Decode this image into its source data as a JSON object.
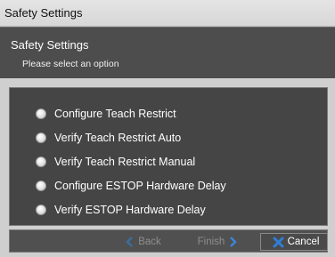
{
  "window": {
    "title": "Safety Settings"
  },
  "header": {
    "title": "Safety Settings",
    "subtitle": "Please select an option"
  },
  "options": [
    {
      "label": "Configure Teach Restrict",
      "selected": false
    },
    {
      "label": "Verify Teach Restrict Auto",
      "selected": false
    },
    {
      "label": "Verify Teach Restrict Manual",
      "selected": false
    },
    {
      "label": "Configure ESTOP Hardware Delay",
      "selected": false
    },
    {
      "label": "Verify ESTOP Hardware Delay",
      "selected": false
    }
  ],
  "footer": {
    "back_label": "Back",
    "finish_label": "Finish",
    "cancel_label": "Cancel",
    "back_enabled": false,
    "finish_enabled": false,
    "cancel_enabled": true
  },
  "colors": {
    "header_bg": "#4d4d4d",
    "panel_bg": "#454545",
    "accent_arrow": "#3b86d6",
    "cancel_icon": "#2f7fd8"
  }
}
